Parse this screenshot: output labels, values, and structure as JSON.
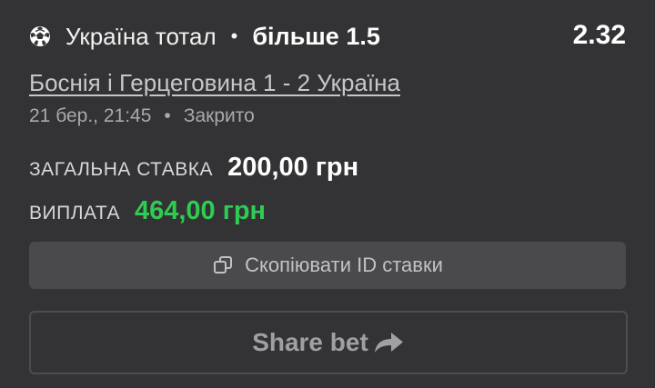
{
  "bet": {
    "sport_icon": "soccer-ball-icon",
    "market": "Україна тотал",
    "separator": "•",
    "selection": "більше 1.5",
    "odds": "2.32"
  },
  "event": {
    "name": "Боснія і Герцеговина 1 - 2 Україна",
    "datetime": "21 бер., 21:45",
    "separator": "•",
    "status": "Закрито"
  },
  "stake": {
    "label": "ЗАГАЛЬНА СТАВКА",
    "value": "200,00 грн"
  },
  "payout": {
    "label": "ВИПЛАТА",
    "value": "464,00 грн",
    "color": "#2fcc52"
  },
  "copy_button": {
    "icon": "copy-icon",
    "label": "Скопіювати ID ставки"
  },
  "share_button": {
    "label": "Share bet",
    "icon": "share-arrow-icon"
  }
}
